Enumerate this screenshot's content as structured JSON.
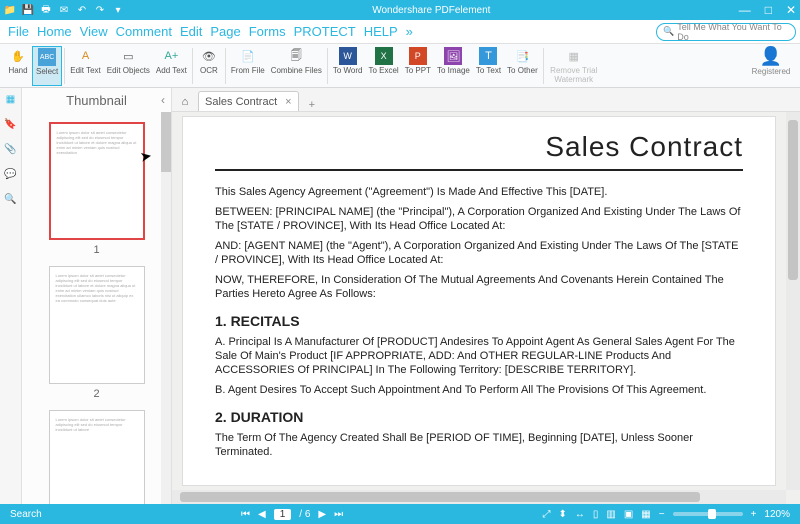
{
  "app": {
    "title": "Wondershare PDFelement"
  },
  "win": {
    "min": "—",
    "max": "□",
    "close": "✕"
  },
  "menu": [
    "File",
    "Home",
    "View",
    "Comment",
    "Edit",
    "Page",
    "Forms",
    "PROTECT",
    "HELP"
  ],
  "menu_after": "»",
  "search": {
    "placeholder": "Tell Me What You Want To Do"
  },
  "toolbar": {
    "hand": "Hand",
    "select": "Select",
    "edittext": "Edit Text",
    "editobj": "Edit Objects",
    "addtext": "Add Text",
    "ocr": "OCR",
    "fromfile": "From File",
    "combine": "Combine Files",
    "toword": "To Word",
    "toexcel": "To Excel",
    "toppt": "To PPT",
    "toimage": "To Image",
    "totext": "To Text",
    "toother": "To Other",
    "removewm": "Remove Trial Watermark",
    "register": "Registered"
  },
  "sidebar": {
    "title": "Thumbnail",
    "collapse": "‹"
  },
  "thumbs": {
    "p1": "1",
    "p2": "2"
  },
  "tab": {
    "name": "Sales Contract",
    "close": "×",
    "plus": "+"
  },
  "doc": {
    "title": "Sales Contract",
    "p1": "This Sales Agency Agreement (\"Agreement\") Is Made And Effective This [DATE].",
    "p2": "BETWEEN: [PRINCIPAL NAME] (the \"Principal\"), A Corporation Organized And Existing Under The Laws Of The [STATE / PROVINCE], With Its Head Office Located At:",
    "p3": "AND: [AGENT NAME] (the \"Agent\"), A Corporation Organized And Existing Under The Laws Of The [STATE / PROVINCE], With Its Head Office Located At:",
    "p4": "NOW, THEREFORE, In Consideration Of The Mutual Agreements And Covenants Herein Contained The Parties Hereto Agree As Follows:",
    "h2a": "1. RECITALS",
    "p5": "A. Principal Is A Manufacturer Of [PRODUCT] Andesires To Appoint Agent As General Sales Agent For The Sale Of Main's Product [IF APPROPRIATE, ADD: And OTHER REGULAR-LINE Products And ACCESSORIES Of PRINCIPAL] In The Following Territory: [DESCRIBE TERRITORY].",
    "p6": "B. Agent Desires To Accept Such Appointment And To Perform All The Provisions Of This Agreement.",
    "h2b": "2. DURATION",
    "p7": "The Term Of The Agency Created Shall Be [PERIOD OF TIME], Beginning [DATE], Unless Sooner Terminated."
  },
  "status": {
    "search": "Search",
    "page": "1",
    "pages": "/ 6",
    "prev": "◀",
    "next": "▶",
    "fit1": "⤢",
    "fit2": "⬍",
    "fit3": "↔",
    "single": "▯",
    "cont": "▥",
    "facing": "▣",
    "facing2": "▦",
    "zoomout": "−",
    "zoomin": "+",
    "zoom": "120%"
  }
}
